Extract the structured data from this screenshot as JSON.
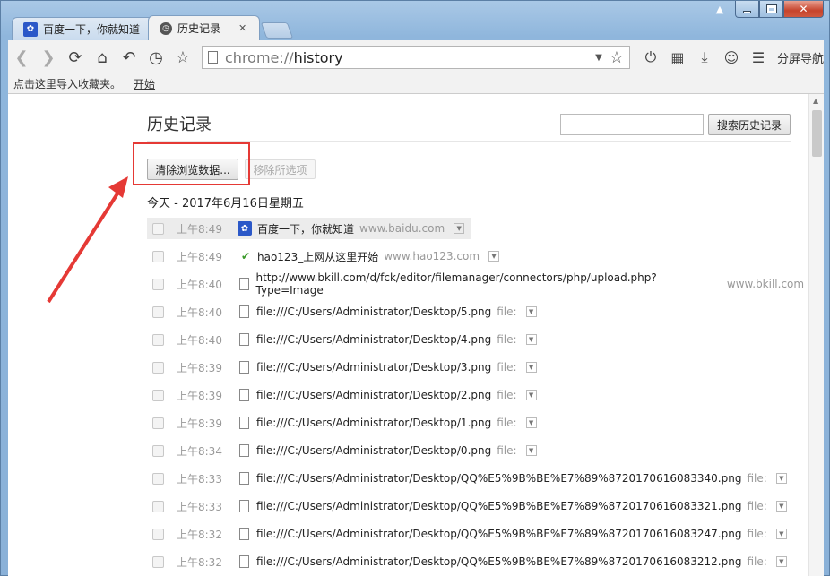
{
  "window": {
    "shirt_icon": "tshirt-icon"
  },
  "tabs": [
    {
      "title": "百度一下，你就知道",
      "icon": "baidu-paw-icon"
    },
    {
      "title": "历史记录",
      "icon": "history-clock-icon",
      "close": "✕"
    }
  ],
  "toolbar": {
    "url_prefix": "chrome://",
    "url_path": "history",
    "split_nav": "分屏导航"
  },
  "bookmarks": {
    "hint": "点击这里导入收藏夹。",
    "start": "开始"
  },
  "page": {
    "title": "历史记录",
    "search_button": "搜索历史记录",
    "search_value": "",
    "clear_button": "清除浏览数据...",
    "remove_button": "移除所选项",
    "day_header": "今天 - 2017年6月16日星期五"
  },
  "history": [
    {
      "time": "上午8:49",
      "icon": "baidu",
      "title": "百度一下，你就知道",
      "domain": "www.baidu.com"
    },
    {
      "time": "上午8:49",
      "icon": "hao",
      "title": "hao123_上网从这里开始",
      "domain": "www.hao123.com"
    },
    {
      "time": "上午8:40",
      "icon": "doc",
      "title": "http://www.bkill.com/d/fck/editor/filemanager/connectors/php/upload.php?Type=Image",
      "domain": "www.bkill.com"
    },
    {
      "time": "上午8:40",
      "icon": "doc",
      "title": "file:///C:/Users/Administrator/Desktop/5.png",
      "domain": "file:"
    },
    {
      "time": "上午8:40",
      "icon": "doc",
      "title": "file:///C:/Users/Administrator/Desktop/4.png",
      "domain": "file:"
    },
    {
      "time": "上午8:39",
      "icon": "doc",
      "title": "file:///C:/Users/Administrator/Desktop/3.png",
      "domain": "file:"
    },
    {
      "time": "上午8:39",
      "icon": "doc",
      "title": "file:///C:/Users/Administrator/Desktop/2.png",
      "domain": "file:"
    },
    {
      "time": "上午8:39",
      "icon": "doc",
      "title": "file:///C:/Users/Administrator/Desktop/1.png",
      "domain": "file:"
    },
    {
      "time": "上午8:34",
      "icon": "doc",
      "title": "file:///C:/Users/Administrator/Desktop/0.png",
      "domain": "file:"
    },
    {
      "time": "上午8:33",
      "icon": "doc",
      "title": "file:///C:/Users/Administrator/Desktop/QQ%E5%9B%BE%E7%89%8720170616083340.png",
      "domain": "file:"
    },
    {
      "time": "上午8:33",
      "icon": "doc",
      "title": "file:///C:/Users/Administrator/Desktop/QQ%E5%9B%BE%E7%89%8720170616083321.png",
      "domain": "file:"
    },
    {
      "time": "上午8:32",
      "icon": "doc",
      "title": "file:///C:/Users/Administrator/Desktop/QQ%E5%9B%BE%E7%89%8720170616083247.png",
      "domain": "file:"
    },
    {
      "time": "上午8:32",
      "icon": "doc",
      "title": "file:///C:/Users/Administrator/Desktop/QQ%E5%9B%BE%E7%89%8720170616083212.png",
      "domain": "file:"
    }
  ],
  "annotation": {
    "highlight_color": "#e53935"
  }
}
